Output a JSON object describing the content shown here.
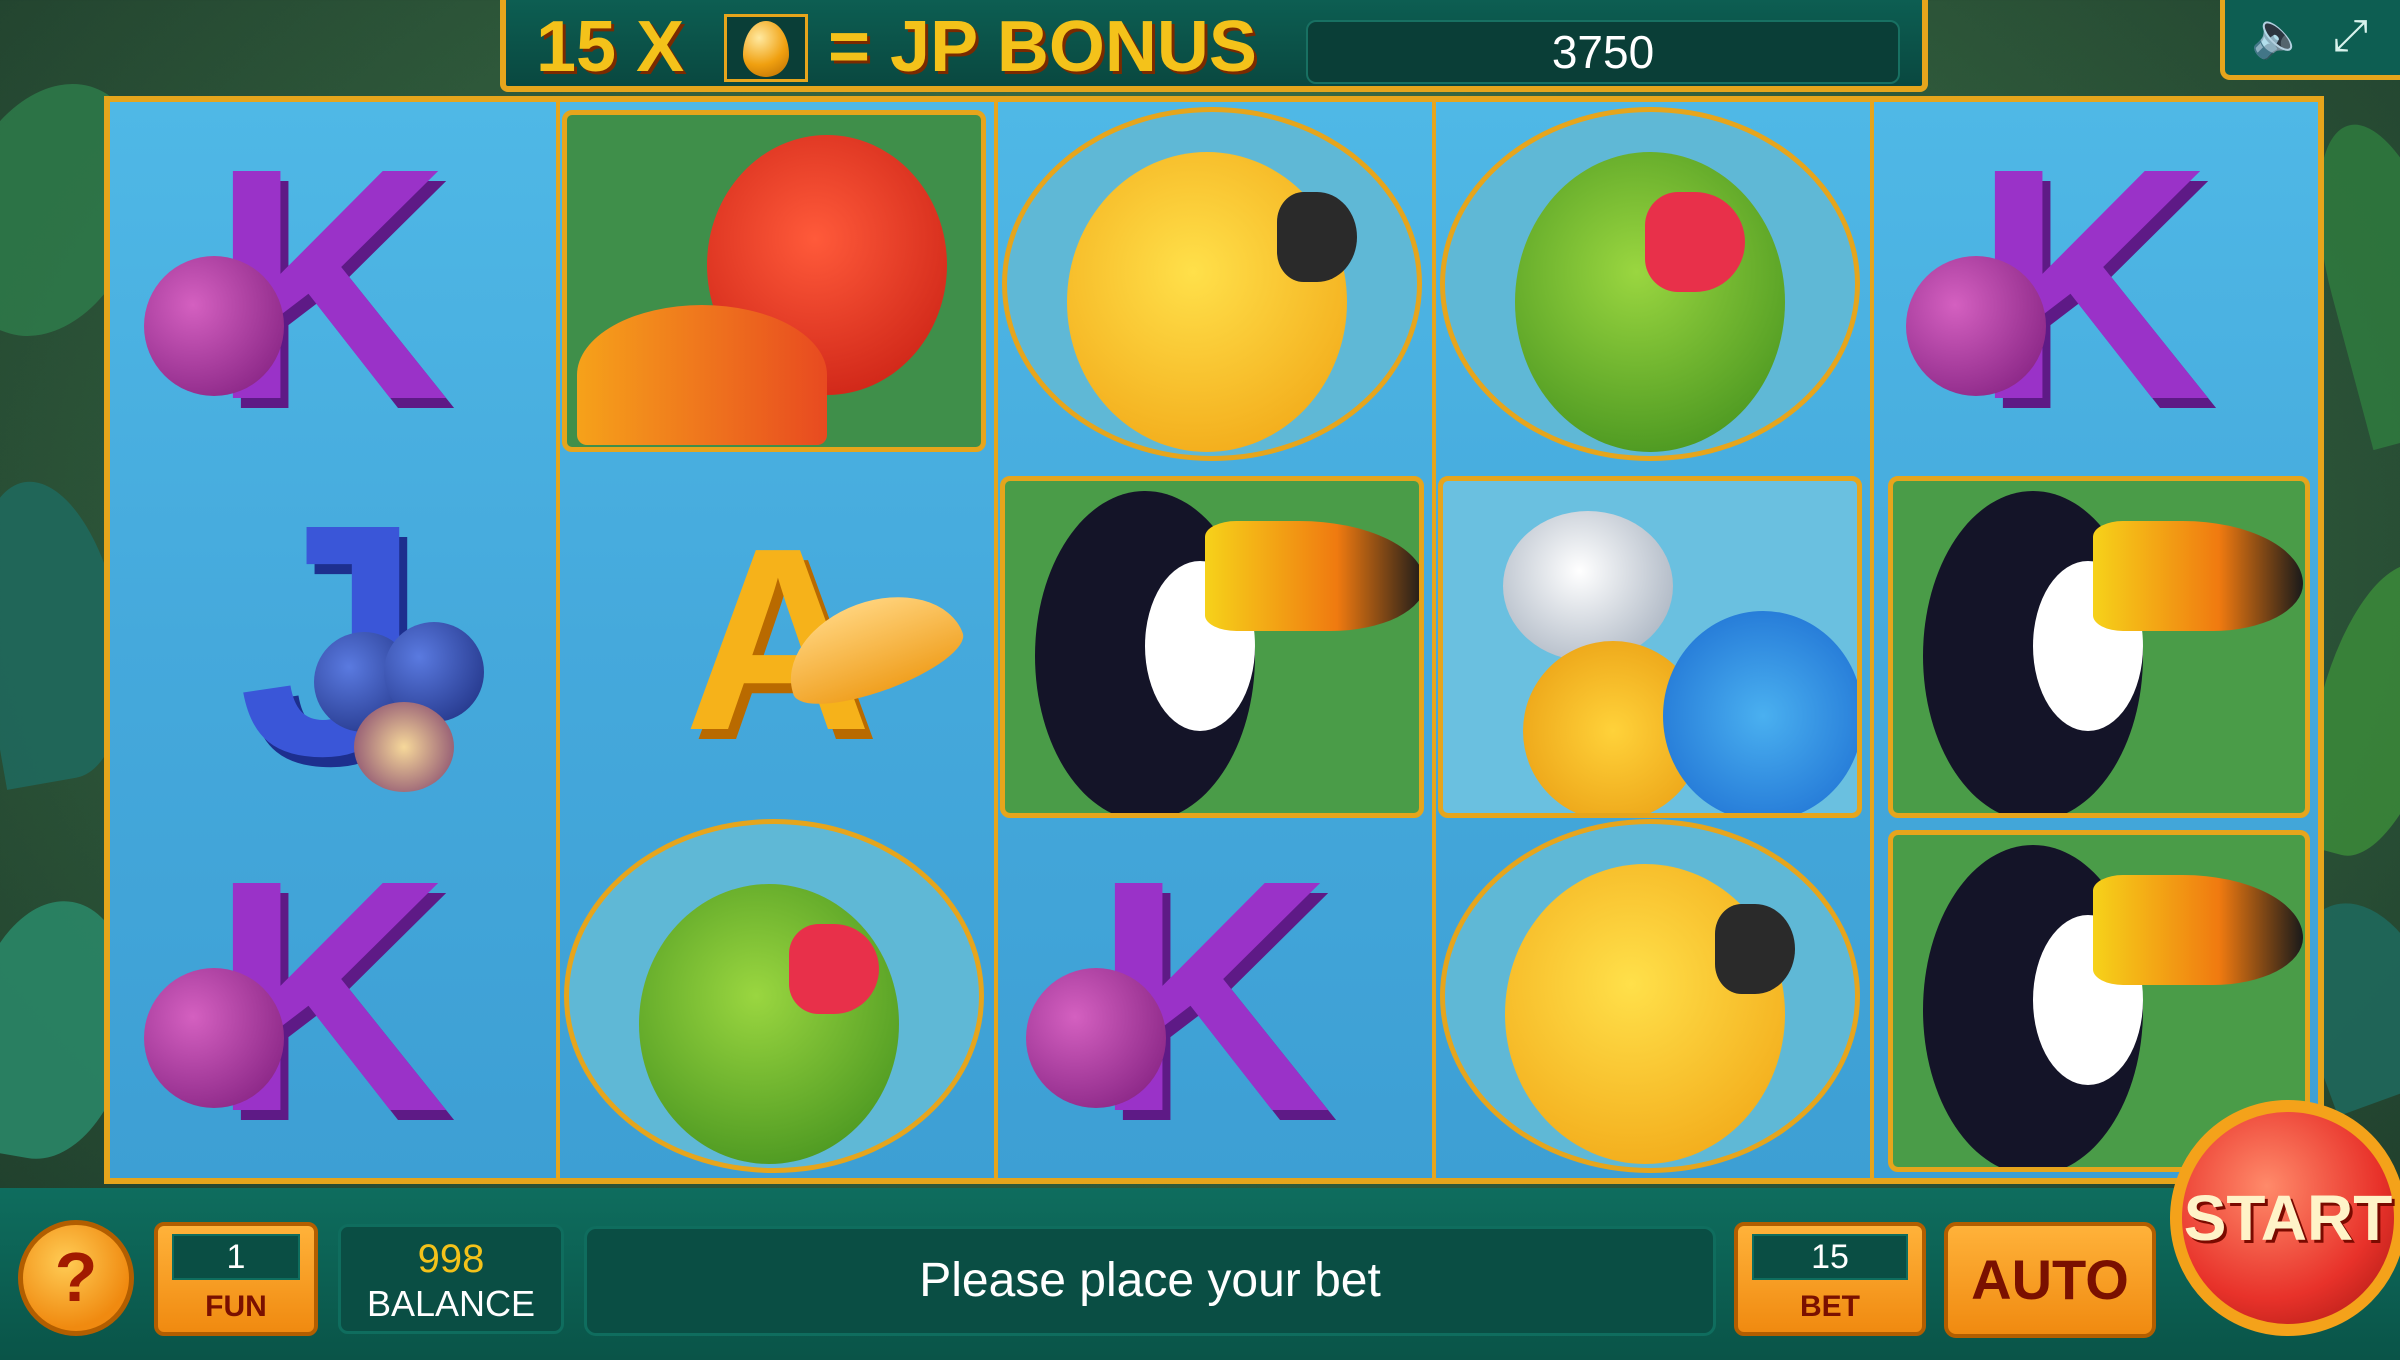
{
  "jackpot": {
    "count": "15 X",
    "label": "= JP BONUS",
    "value": "3750",
    "icon": "golden-egg-icon"
  },
  "controls": {
    "sound_icon": "speaker-icon",
    "fullscreen_icon": "expand-icon"
  },
  "reels": [
    [
      "K",
      "red-parrot",
      "J",
      "A"
    ],
    [
      "K",
      "red-parrot",
      "A",
      "green-parrot"
    ],
    [
      "yellow-parrot",
      "toucan",
      "K"
    ],
    [
      "green-parrot",
      "macaw",
      "yellow-parrot"
    ],
    [
      "K",
      "toucan",
      "toucan"
    ]
  ],
  "symbols": {
    "k": "K",
    "j": "J",
    "a": "A"
  },
  "bottom": {
    "help": "?",
    "fun_value": "1",
    "fun_label": "FUN",
    "balance_value": "998",
    "balance_label": "BALANCE",
    "message": "Please place your bet",
    "bet_value": "15",
    "bet_label": "BET",
    "auto": "AUTO",
    "start": "START"
  },
  "colors": {
    "accent_gold": "#e6a51c",
    "panel_teal": "#0d5e52",
    "start_red": "#e8322a",
    "reel_blue": "#45a9dc"
  }
}
